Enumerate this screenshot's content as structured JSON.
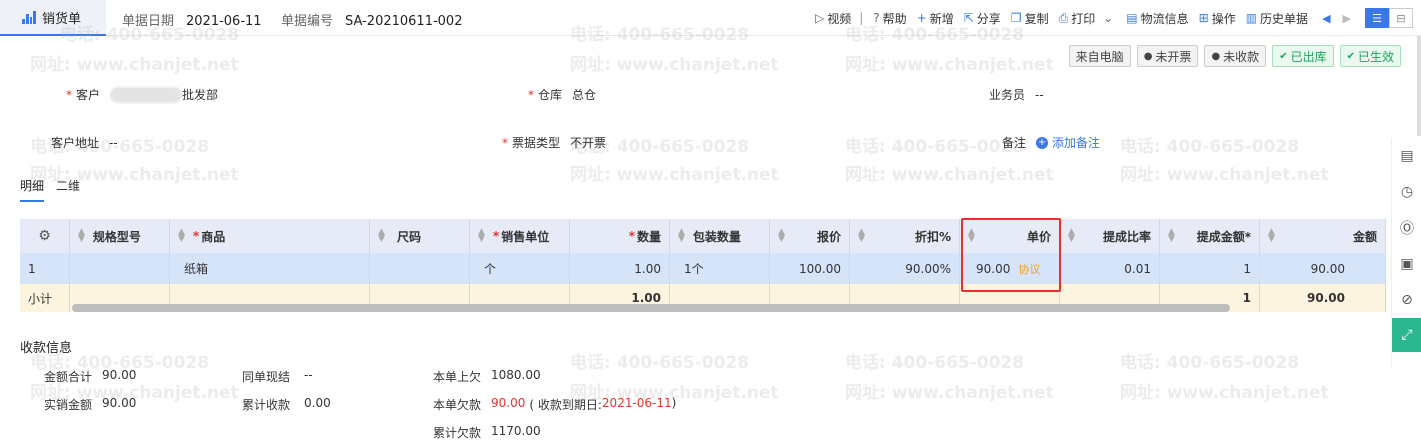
{
  "topbar": {
    "tab_title": "销货单",
    "date_label": "单据日期",
    "date_value": "2021-06-11",
    "doc_no_label": "单据编号",
    "doc_no_value": "SA-20210611-002",
    "tools": {
      "video": "视频",
      "help": "帮助",
      "new": "新增",
      "share": "分享",
      "copy": "复制",
      "print": "打印",
      "logistics": "物流信息",
      "operate": "操作",
      "history": "历史单据"
    }
  },
  "badges": {
    "from_pc": "来自电脑",
    "not_invoiced": "未开票",
    "not_collected": "未收款",
    "stocked_out": "已出库",
    "effective": "已生效"
  },
  "watermark": {
    "phone": "电话: 400-665-0028",
    "url": "网址: www.chanjet.net"
  },
  "form": {
    "customer_label": "客户",
    "customer_value": "批发部",
    "warehouse_label": "仓库",
    "warehouse_value": "总仓",
    "salesman_label": "业务员",
    "salesman_value": "--",
    "address_label": "客户地址",
    "address_value": "--",
    "invoice_type_label": "票据类型",
    "invoice_type_value": "不开票",
    "remark_label": "备注",
    "add_remark": "添加备注"
  },
  "subtabs": [
    "明细",
    "二维"
  ],
  "grid": {
    "headers": {
      "spec": "规格型号",
      "product": "商品",
      "size": "尺码",
      "unit": "销售单位",
      "qty": "数量",
      "pack_qty": "包装数量",
      "quote": "报价",
      "discount": "折扣%",
      "price": "单价",
      "commission_rate": "提成比率",
      "commission_amount": "提成金额*",
      "amount": "金额"
    },
    "row": {
      "index": "1",
      "spec": "",
      "product": "纸箱",
      "size": "",
      "unit": "个",
      "qty": "1.00",
      "pack_qty": "1个",
      "quote": "100.00",
      "discount": "90.00%",
      "price": "90.00",
      "price_tag": "协议",
      "commission_rate": "0.01",
      "commission_amount": "1",
      "amount": "90.00"
    },
    "subtotal": {
      "label": "小计",
      "qty": "1.00",
      "commission_amount": "1",
      "amount": "90.00"
    }
  },
  "payment": {
    "title": "收款信息",
    "total_label": "金额合计",
    "total_value": "90.00",
    "actual_label": "实销金额",
    "actual_value": "90.00",
    "settle_label": "同单现结",
    "settle_value": "--",
    "accum_collect_label": "累计收款",
    "accum_collect_value": "0.00",
    "prev_owe_label": "本单上欠",
    "prev_owe_value": "1080.00",
    "owe_label": "本单欠款",
    "owe_value": "90.00",
    "due_prefix": "( 收款到期日: ",
    "due_date": "2021-06-11",
    "due_suffix": " )",
    "accum_owe_label": "累计欠款",
    "accum_owe_value": "1170.00"
  }
}
